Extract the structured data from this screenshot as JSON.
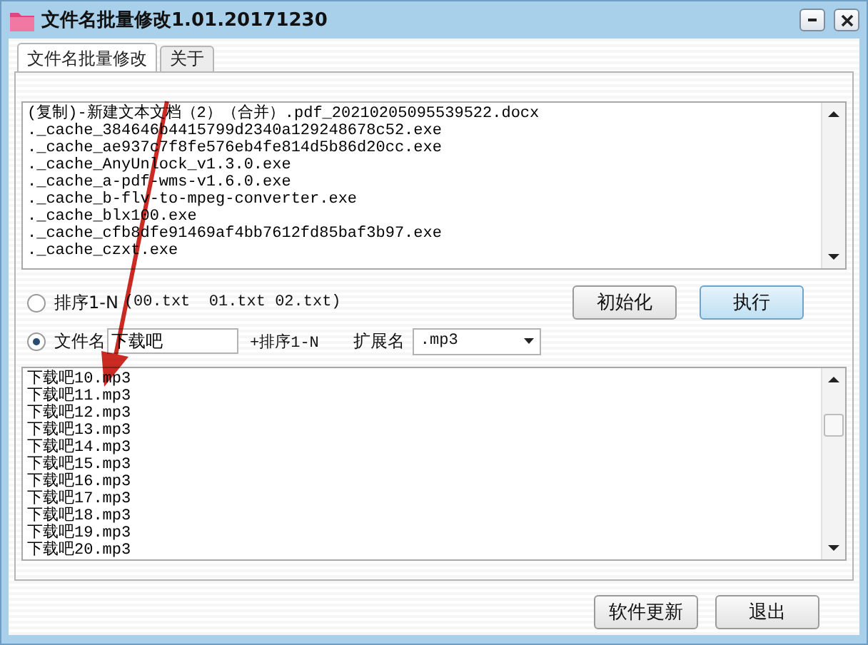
{
  "window": {
    "title": "文件名批量修改1.01.20171230"
  },
  "tabs": [
    {
      "label": "文件名批量修改",
      "selected": true
    },
    {
      "label": "关于",
      "selected": false
    }
  ],
  "source_files": [
    "(复制)-新建文本文档（2）（合并）.pdf_20210205095539522.docx",
    "._cache_384646b4415799d2340a129248678c52.exe",
    "._cache_ae937c7f8fe576eb4fe814d5b86d20cc.exe",
    "._cache_AnyUnlock_v1.3.0.exe",
    "._cache_a-pdf-wms-v1.6.0.exe",
    "._cache_b-flv-to-mpeg-converter.exe",
    "._cache_blx100.exe",
    "._cache_cfb8dfe91469af4bb7612fd85baf3b97.exe",
    "._cache_czxt.exe"
  ],
  "options": [
    {
      "kind": "sequence",
      "label": "排序1-N",
      "hint": "(00.txt  01.txt 02.txt)",
      "selected": false
    },
    {
      "kind": "name",
      "label": "文件名",
      "value": "下载吧",
      "suffix": "+排序1-N",
      "selected": true
    }
  ],
  "extension": {
    "label": "扩展名",
    "value": ".mp3"
  },
  "actions": [
    {
      "label": "初始化",
      "default": false
    },
    {
      "label": "执行",
      "default": true
    }
  ],
  "results": [
    "下载吧10.mp3",
    "下载吧11.mp3",
    "下载吧12.mp3",
    "下载吧13.mp3",
    "下载吧14.mp3",
    "下载吧15.mp3",
    "下载吧16.mp3",
    "下载吧17.mp3",
    "下载吧18.mp3",
    "下载吧19.mp3",
    "下载吧20.mp3"
  ],
  "footer_buttons": [
    "软件更新",
    "退出"
  ],
  "annotations": [
    {
      "kind": "arrow",
      "color": "#cc2a22"
    }
  ]
}
